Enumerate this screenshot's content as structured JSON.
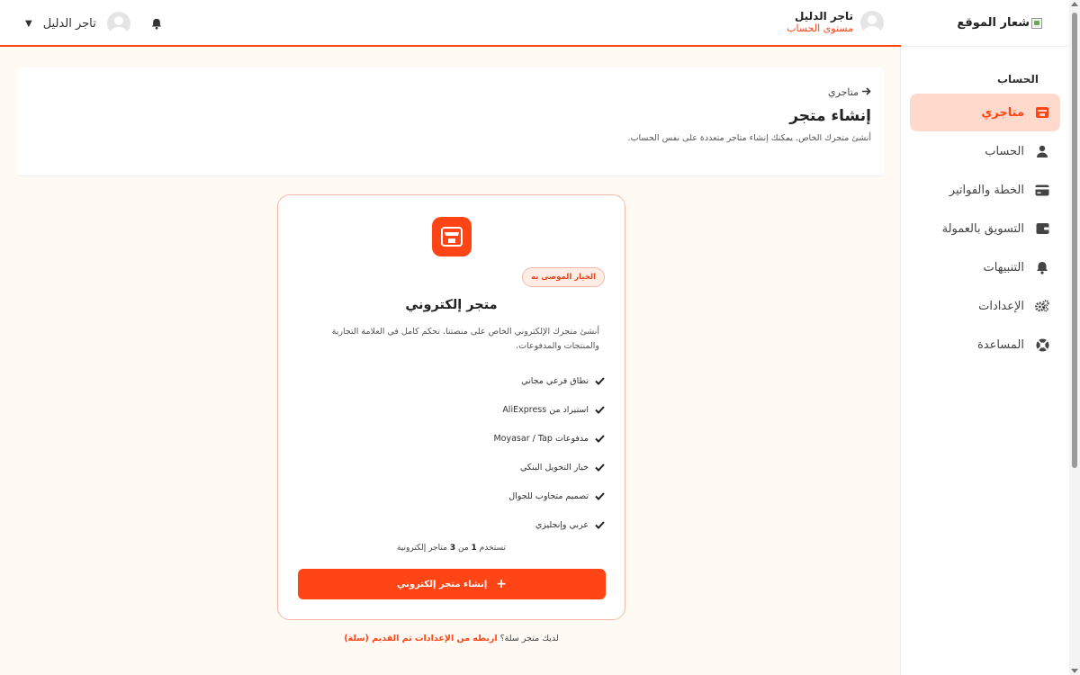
{
  "sidebar": {
    "logo_text": "شعار الموقع",
    "section_title": "الحساب",
    "items": [
      {
        "label": "متاجري",
        "icon": "store-icon",
        "active": true
      },
      {
        "label": "الحساب",
        "icon": "user-icon",
        "active": false
      },
      {
        "label": "الخطة والفواتير",
        "icon": "credit-card-icon",
        "active": false
      },
      {
        "label": "التسويق بالعمولة",
        "icon": "wallet-icon",
        "active": false
      },
      {
        "label": "التنبيهات",
        "icon": "bell-icon",
        "active": false
      },
      {
        "label": "الإعدادات",
        "icon": "gears-icon",
        "active": false
      },
      {
        "label": "المساعدة",
        "icon": "life-ring-icon",
        "active": false
      }
    ]
  },
  "header": {
    "user_name": "تاجر الدليل",
    "account_level": "مستوى الحساب",
    "dropdown_name": "تاجر الدليل"
  },
  "page": {
    "breadcrumb": "متاجري",
    "title": "إنشاء متجر",
    "description": "أنشئ متجرك الخاص. يمكنك إنشاء متاجر متعددة على نفس الحساب."
  },
  "store_card": {
    "badge": "الخيار الموصى به",
    "title": "متجر إلكتروني",
    "description": "أنشئ متجرك الإلكتروني الخاص على منصتنا. تحكم كامل في العلامة التجارية والمنتجات والمدفوعات.",
    "features": [
      "نطاق فرعي مجاني",
      "استيراد من AliExpress",
      "مدفوعات Moyasar / Tap",
      "خيار التحويل البنكي",
      "تصميم متجاوب للجوال",
      "عربي وإنجليزي"
    ],
    "usage_prefix": "تستخدم",
    "usage_used": "1",
    "usage_mid": "من",
    "usage_total": "3",
    "usage_suffix": "متاجر إلكترونية",
    "button_label": "إنشاء متجر إلكتروني"
  },
  "footer": {
    "question": "لديك متجر سلة؟",
    "link": "اربطه من الإعدادات ثم القديم (سلة)"
  },
  "colors": {
    "accent": "#ff4415",
    "active_bg": "#ffd9cc",
    "page_bg": "#fffaf4"
  }
}
